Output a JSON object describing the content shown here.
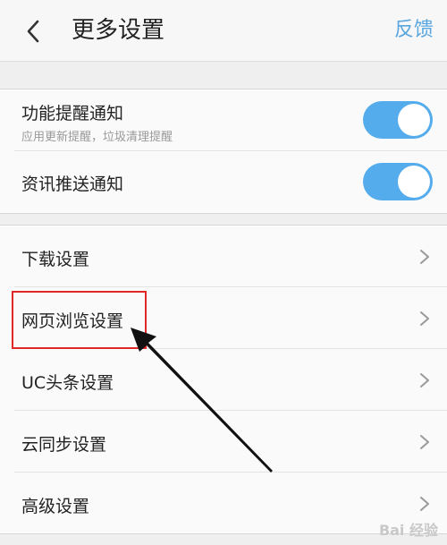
{
  "header": {
    "title": "更多设置",
    "feedback_label": "反馈"
  },
  "notifications": [
    {
      "title": "功能提醒通知",
      "subtitle": "应用更新提醒，垃圾清理提醒",
      "toggle_on": true
    },
    {
      "title": "资讯推送通知",
      "toggle_on": true
    }
  ],
  "settings": [
    {
      "label": "下载设置"
    },
    {
      "label": "网页浏览设置"
    },
    {
      "label": "UC头条设置"
    },
    {
      "label": "云同步设置"
    },
    {
      "label": "高级设置"
    }
  ],
  "watermark": "Bai 经验",
  "colors": {
    "accent": "#55acec",
    "highlight_box": "#e02828"
  },
  "icons": {
    "back": "chevron-left-icon",
    "row": "chevron-right-icon"
  }
}
